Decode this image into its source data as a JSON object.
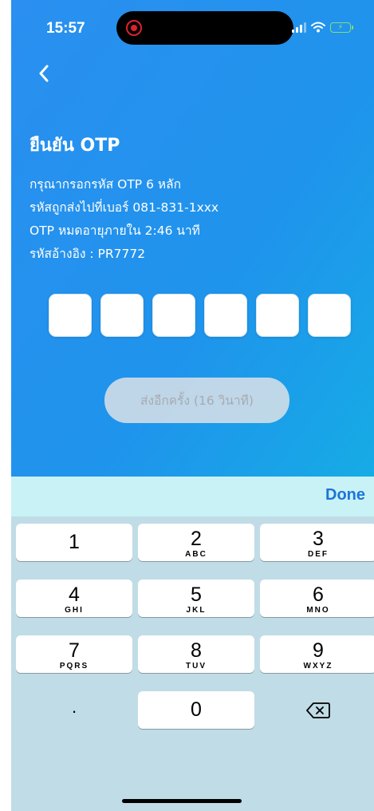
{
  "status": {
    "time": "15:57"
  },
  "page": {
    "title": "ยืนยัน OTP",
    "lines": [
      "กรุณากรอกรหัส OTP 6 หลัก",
      "รหัสถูกส่งไปที่เบอร์ 081-831-1xxx",
      "OTP หมดอายุภายใน 2:46 นาที",
      "รหัสอ้างอิง : PR7772"
    ],
    "resend_label": "ส่งอีกครั้ง (16 วินาที)"
  },
  "keyboard": {
    "done_label": "Done",
    "keys": [
      {
        "num": "1",
        "letters": ""
      },
      {
        "num": "2",
        "letters": "ABC"
      },
      {
        "num": "3",
        "letters": "DEF"
      },
      {
        "num": "4",
        "letters": "GHI"
      },
      {
        "num": "5",
        "letters": "JKL"
      },
      {
        "num": "6",
        "letters": "MNO"
      },
      {
        "num": "7",
        "letters": "PQRS"
      },
      {
        "num": "8",
        "letters": "TUV"
      },
      {
        "num": "9",
        "letters": "WXYZ"
      }
    ],
    "dot": ".",
    "zero": "0"
  },
  "colors": {
    "accent": "#1f74d8",
    "background_start": "#2a8ff0",
    "background_end": "#0fc8df"
  },
  "icons": {
    "back": "chevron-left-icon",
    "delete": "delete-backspace-icon"
  }
}
